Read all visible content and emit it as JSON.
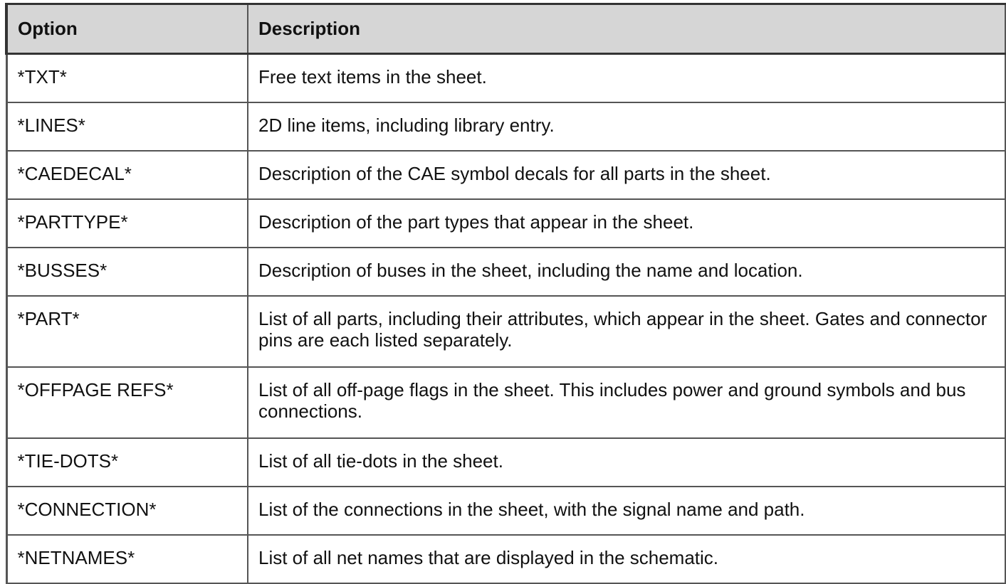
{
  "table": {
    "headers": [
      "Option",
      "Description"
    ],
    "rows": [
      {
        "option": "*TXT*",
        "description": "Free text items in the sheet."
      },
      {
        "option": "*LINES*",
        "description": "2D line items, including library entry."
      },
      {
        "option": "*CAEDECAL*",
        "description": "Description of the CAE symbol decals for all parts in the sheet."
      },
      {
        "option": "*PARTTYPE*",
        "description": "Description of the part types that appear in the sheet."
      },
      {
        "option": "*BUSSES*",
        "description": "Description of buses in the sheet, including the name and location."
      },
      {
        "option": "*PART*",
        "description": "List of all parts, including their attributes, which appear in the sheet. Gates and connector pins are each listed separately."
      },
      {
        "option": "*OFFPAGE REFS*",
        "description": "List of all off-page flags in the sheet. This includes power and ground symbols and bus connections."
      },
      {
        "option": "*TIE-DOTS*",
        "description": "List of all tie-dots in the sheet."
      },
      {
        "option": "*CONNECTION*",
        "description": "List of the connections in the sheet, with the signal name and path."
      },
      {
        "option": "*NETNAMES*",
        "description": "List of all net names that are displayed in the schematic."
      }
    ]
  }
}
